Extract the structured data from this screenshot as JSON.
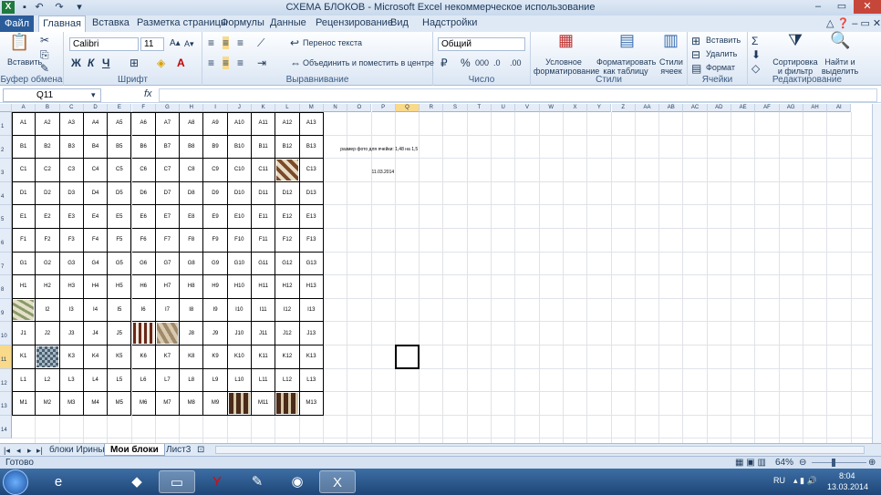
{
  "title": "СХЕМА БЛОКОВ  -  Microsoft Excel некоммерческое использование",
  "tabs": [
    "Файл",
    "Главная",
    "Вставка",
    "Разметка страницы",
    "Формулы",
    "Данные",
    "Рецензирование",
    "Вид",
    "Надстройки"
  ],
  "ribbon": {
    "paste": "Вставить",
    "clipboard": "Буфер обмена",
    "font_name": "Calibri",
    "font_size": "11",
    "font": "Шрифт",
    "bold": "Ж",
    "italic": "К",
    "underline": "Ч",
    "wrap_text": "Перенос текста",
    "merge": "Объединить и поместить в центре",
    "alignment": "Выравнивание",
    "number_format": "Общий",
    "number": "Число",
    "percent": "%",
    "thousands": "000",
    "conditional": "Условное форматирование",
    "as_table": "Форматировать как таблицу",
    "cell_styles": "Стили ячеек",
    "styles": "Стили",
    "insert": "Вставить",
    "delete": "Удалить",
    "format": "Формат",
    "cells": "Ячейки",
    "sort": "Сортировка и фильтр",
    "find": "Найти и выделить",
    "editing": "Редактирование"
  },
  "namebox": "Q11",
  "fx": "fx",
  "columns": [
    "A",
    "B",
    "C",
    "D",
    "E",
    "F",
    "G",
    "H",
    "I",
    "J",
    "K",
    "L",
    "M",
    "N",
    "O",
    "P",
    "Q",
    "R",
    "S",
    "T",
    "U",
    "V",
    "W",
    "X",
    "Y",
    "Z",
    "AA",
    "AB",
    "AC",
    "AD",
    "AE",
    "AF",
    "AG",
    "AH",
    "AI"
  ],
  "selected_col": "Q",
  "selected_row": "11",
  "rows": [
    "1",
    "2",
    "3",
    "4",
    "5",
    "6",
    "7",
    "8",
    "9",
    "10",
    "11",
    "12",
    "13",
    "14"
  ],
  "blocks": [
    [
      "A1",
      "A2",
      "A3",
      "A4",
      "A5",
      "A6",
      "A7",
      "A8",
      "A9",
      "A10",
      "A11",
      "A12",
      "A13"
    ],
    [
      "B1",
      "B2",
      "B3",
      "B4",
      "B5",
      "B6",
      "B7",
      "B8",
      "B9",
      "B10",
      "B11",
      "B12",
      "B13"
    ],
    [
      "C1",
      "C2",
      "C3",
      "C4",
      "C5",
      "C6",
      "C7",
      "C8",
      "C9",
      "C10",
      "C11",
      "",
      "C13"
    ],
    [
      "D1",
      "D2",
      "D3",
      "D4",
      "D5",
      "D6",
      "D7",
      "D8",
      "D9",
      "D10",
      "D11",
      "D12",
      "D13"
    ],
    [
      "E1",
      "E2",
      "E3",
      "E4",
      "E5",
      "E6",
      "E7",
      "E8",
      "E9",
      "E10",
      "E11",
      "E12",
      "E13"
    ],
    [
      "F1",
      "F2",
      "F3",
      "F4",
      "F5",
      "F6",
      "F7",
      "F8",
      "F9",
      "F10",
      "F11",
      "F12",
      "F13"
    ],
    [
      "G1",
      "G2",
      "G3",
      "G4",
      "G5",
      "G6",
      "G7",
      "G8",
      "G9",
      "G10",
      "G11",
      "G12",
      "G13"
    ],
    [
      "H1",
      "H2",
      "H3",
      "H4",
      "H5",
      "H6",
      "H7",
      "H8",
      "H9",
      "H10",
      "H11",
      "H12",
      "H13"
    ],
    [
      "",
      "I2",
      "I3",
      "I4",
      "I5",
      "I6",
      "I7",
      "I8",
      "I9",
      "I10",
      "I11",
      "I12",
      "I13"
    ],
    [
      "J1",
      "J2",
      "J3",
      "J4",
      "J5",
      "",
      "",
      "J8",
      "J9",
      "J10",
      "J11",
      "J12",
      "J13"
    ],
    [
      "K1",
      "",
      "K3",
      "K4",
      "K5",
      "K6",
      "K7",
      "K8",
      "K9",
      "K10",
      "K11",
      "K12",
      "K13"
    ],
    [
      "L1",
      "L2",
      "L3",
      "L4",
      "L5",
      "L6",
      "L7",
      "L8",
      "L9",
      "L10",
      "L11",
      "L12",
      "L13"
    ],
    [
      "M1",
      "M2",
      "M3",
      "M4",
      "M5",
      "M6",
      "M7",
      "M8",
      "M9",
      "",
      "M11",
      "",
      "M13"
    ]
  ],
  "note": "размер фото для ячейки: 1,48 на 1,5",
  "date": "11.03.2014",
  "sheets": [
    "блоки Ирины",
    "Мои блоки",
    "Лист3"
  ],
  "active_sheet": "Мои блоки",
  "status": "Готово",
  "zoom": "64%",
  "lang": "RU",
  "time": "8:04",
  "date_tray": "13.03.2014"
}
